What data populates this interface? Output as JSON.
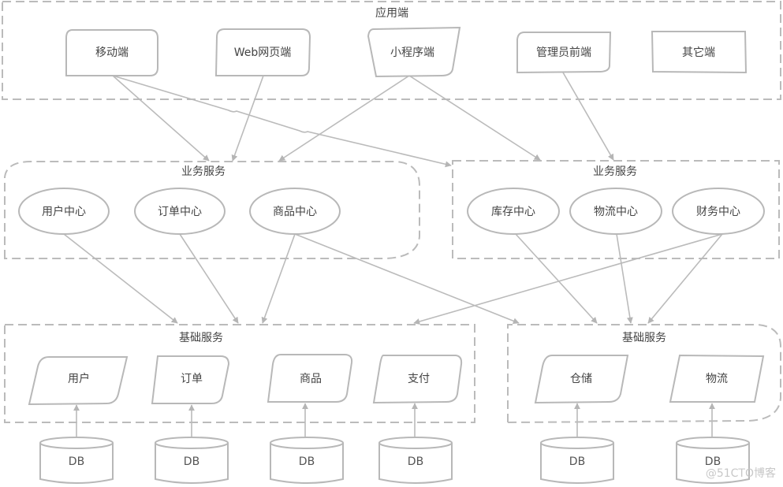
{
  "diagram": {
    "groups": {
      "app": {
        "title": "应用端"
      },
      "biz_left": {
        "title": "业务服务"
      },
      "biz_right": {
        "title": "业务服务"
      },
      "base_left": {
        "title": "基础服务"
      },
      "base_right": {
        "title": "基础服务"
      }
    },
    "clients": [
      {
        "id": "mobile",
        "label": "移动端"
      },
      {
        "id": "web",
        "label": "Web网页端"
      },
      {
        "id": "miniprogram",
        "label": "小程序端"
      },
      {
        "id": "admin",
        "label": "管理员前端"
      },
      {
        "id": "other",
        "label": "其它端"
      }
    ],
    "biz_services": [
      {
        "id": "user-center",
        "label": "用户中心",
        "group": "biz_left"
      },
      {
        "id": "order-center",
        "label": "订单中心",
        "group": "biz_left"
      },
      {
        "id": "product-center",
        "label": "商品中心",
        "group": "biz_left"
      },
      {
        "id": "inventory-center",
        "label": "库存中心",
        "group": "biz_right"
      },
      {
        "id": "logistics-center",
        "label": "物流中心",
        "group": "biz_right"
      },
      {
        "id": "finance-center",
        "label": "财务中心",
        "group": "biz_right"
      }
    ],
    "base_services": [
      {
        "id": "user",
        "label": "用户",
        "group": "base_left"
      },
      {
        "id": "order",
        "label": "订单",
        "group": "base_left"
      },
      {
        "id": "product",
        "label": "商品",
        "group": "base_left"
      },
      {
        "id": "payment",
        "label": "支付",
        "group": "base_left"
      },
      {
        "id": "warehouse",
        "label": "仓储",
        "group": "base_right"
      },
      {
        "id": "logistics",
        "label": "物流",
        "group": "base_right"
      }
    ],
    "databases": [
      {
        "id": "db-user",
        "label": "DB",
        "serves": "user"
      },
      {
        "id": "db-order",
        "label": "DB",
        "serves": "order"
      },
      {
        "id": "db-product",
        "label": "DB",
        "serves": "product"
      },
      {
        "id": "db-payment",
        "label": "DB",
        "serves": "payment"
      },
      {
        "id": "db-warehouse",
        "label": "DB",
        "serves": "warehouse"
      },
      {
        "id": "db-logistics",
        "label": "DB",
        "serves": "logistics"
      }
    ],
    "edges": [
      {
        "from": "mobile",
        "to": "biz_left"
      },
      {
        "from": "mobile",
        "to": "biz_right"
      },
      {
        "from": "web",
        "to": "biz_left"
      },
      {
        "from": "miniprogram",
        "to": "biz_left"
      },
      {
        "from": "miniprogram",
        "to": "biz_right"
      },
      {
        "from": "admin",
        "to": "biz_right"
      },
      {
        "from": "user-center",
        "to": "base_left"
      },
      {
        "from": "order-center",
        "to": "base_left"
      },
      {
        "from": "product-center",
        "to": "base_left"
      },
      {
        "from": "product-center",
        "to": "base_right"
      },
      {
        "from": "inventory-center",
        "to": "base_right"
      },
      {
        "from": "logistics-center",
        "to": "base_right"
      },
      {
        "from": "finance-center",
        "to": "base_left"
      },
      {
        "from": "finance-center",
        "to": "base_right"
      },
      {
        "from": "db-user",
        "to": "user"
      },
      {
        "from": "db-order",
        "to": "order"
      },
      {
        "from": "db-product",
        "to": "product"
      },
      {
        "from": "db-payment",
        "to": "payment"
      },
      {
        "from": "db-warehouse",
        "to": "warehouse"
      },
      {
        "from": "db-logistics",
        "to": "logistics"
      }
    ],
    "colors": {
      "stroke": "#bbbbbb",
      "text": "#444444"
    }
  },
  "watermark": "@51CTO博客"
}
